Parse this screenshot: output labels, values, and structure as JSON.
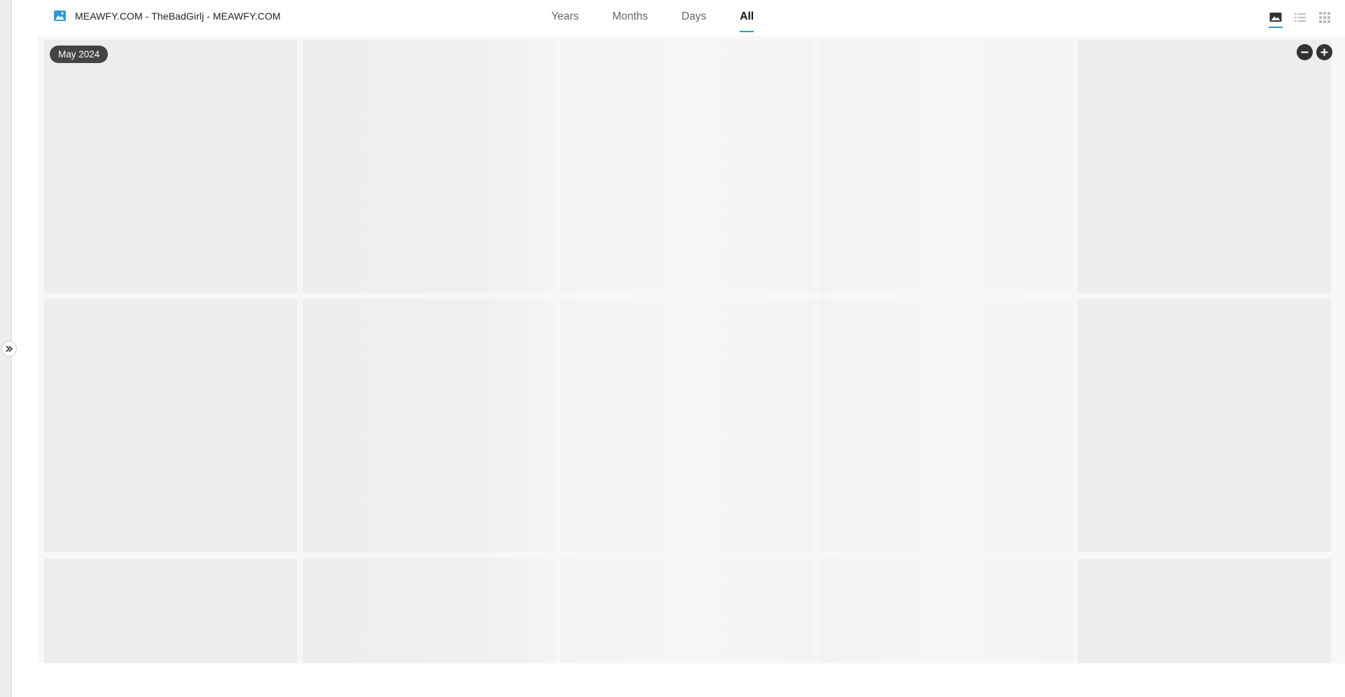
{
  "album": {
    "title": "MEAWFY.COM - TheBadGirlj - MEAWFY.COM",
    "icon": "image-icon"
  },
  "tabs": [
    {
      "label": "Years",
      "active": false
    },
    {
      "label": "Months",
      "active": false
    },
    {
      "label": "Days",
      "active": false
    },
    {
      "label": "All",
      "active": true
    }
  ],
  "view_modes": [
    {
      "name": "photo-view-icon",
      "active": true
    },
    {
      "name": "list-view-icon",
      "active": false
    },
    {
      "name": "grid-view-icon",
      "active": false
    }
  ],
  "timeline": {
    "date_label": "May 2024"
  },
  "zoom": {
    "out_icon": "minus-icon",
    "in_icon": "plus-icon"
  },
  "colors": {
    "accent": "#2b9ad6",
    "pill": "#444444",
    "tile_placeholder": "#ededed"
  }
}
